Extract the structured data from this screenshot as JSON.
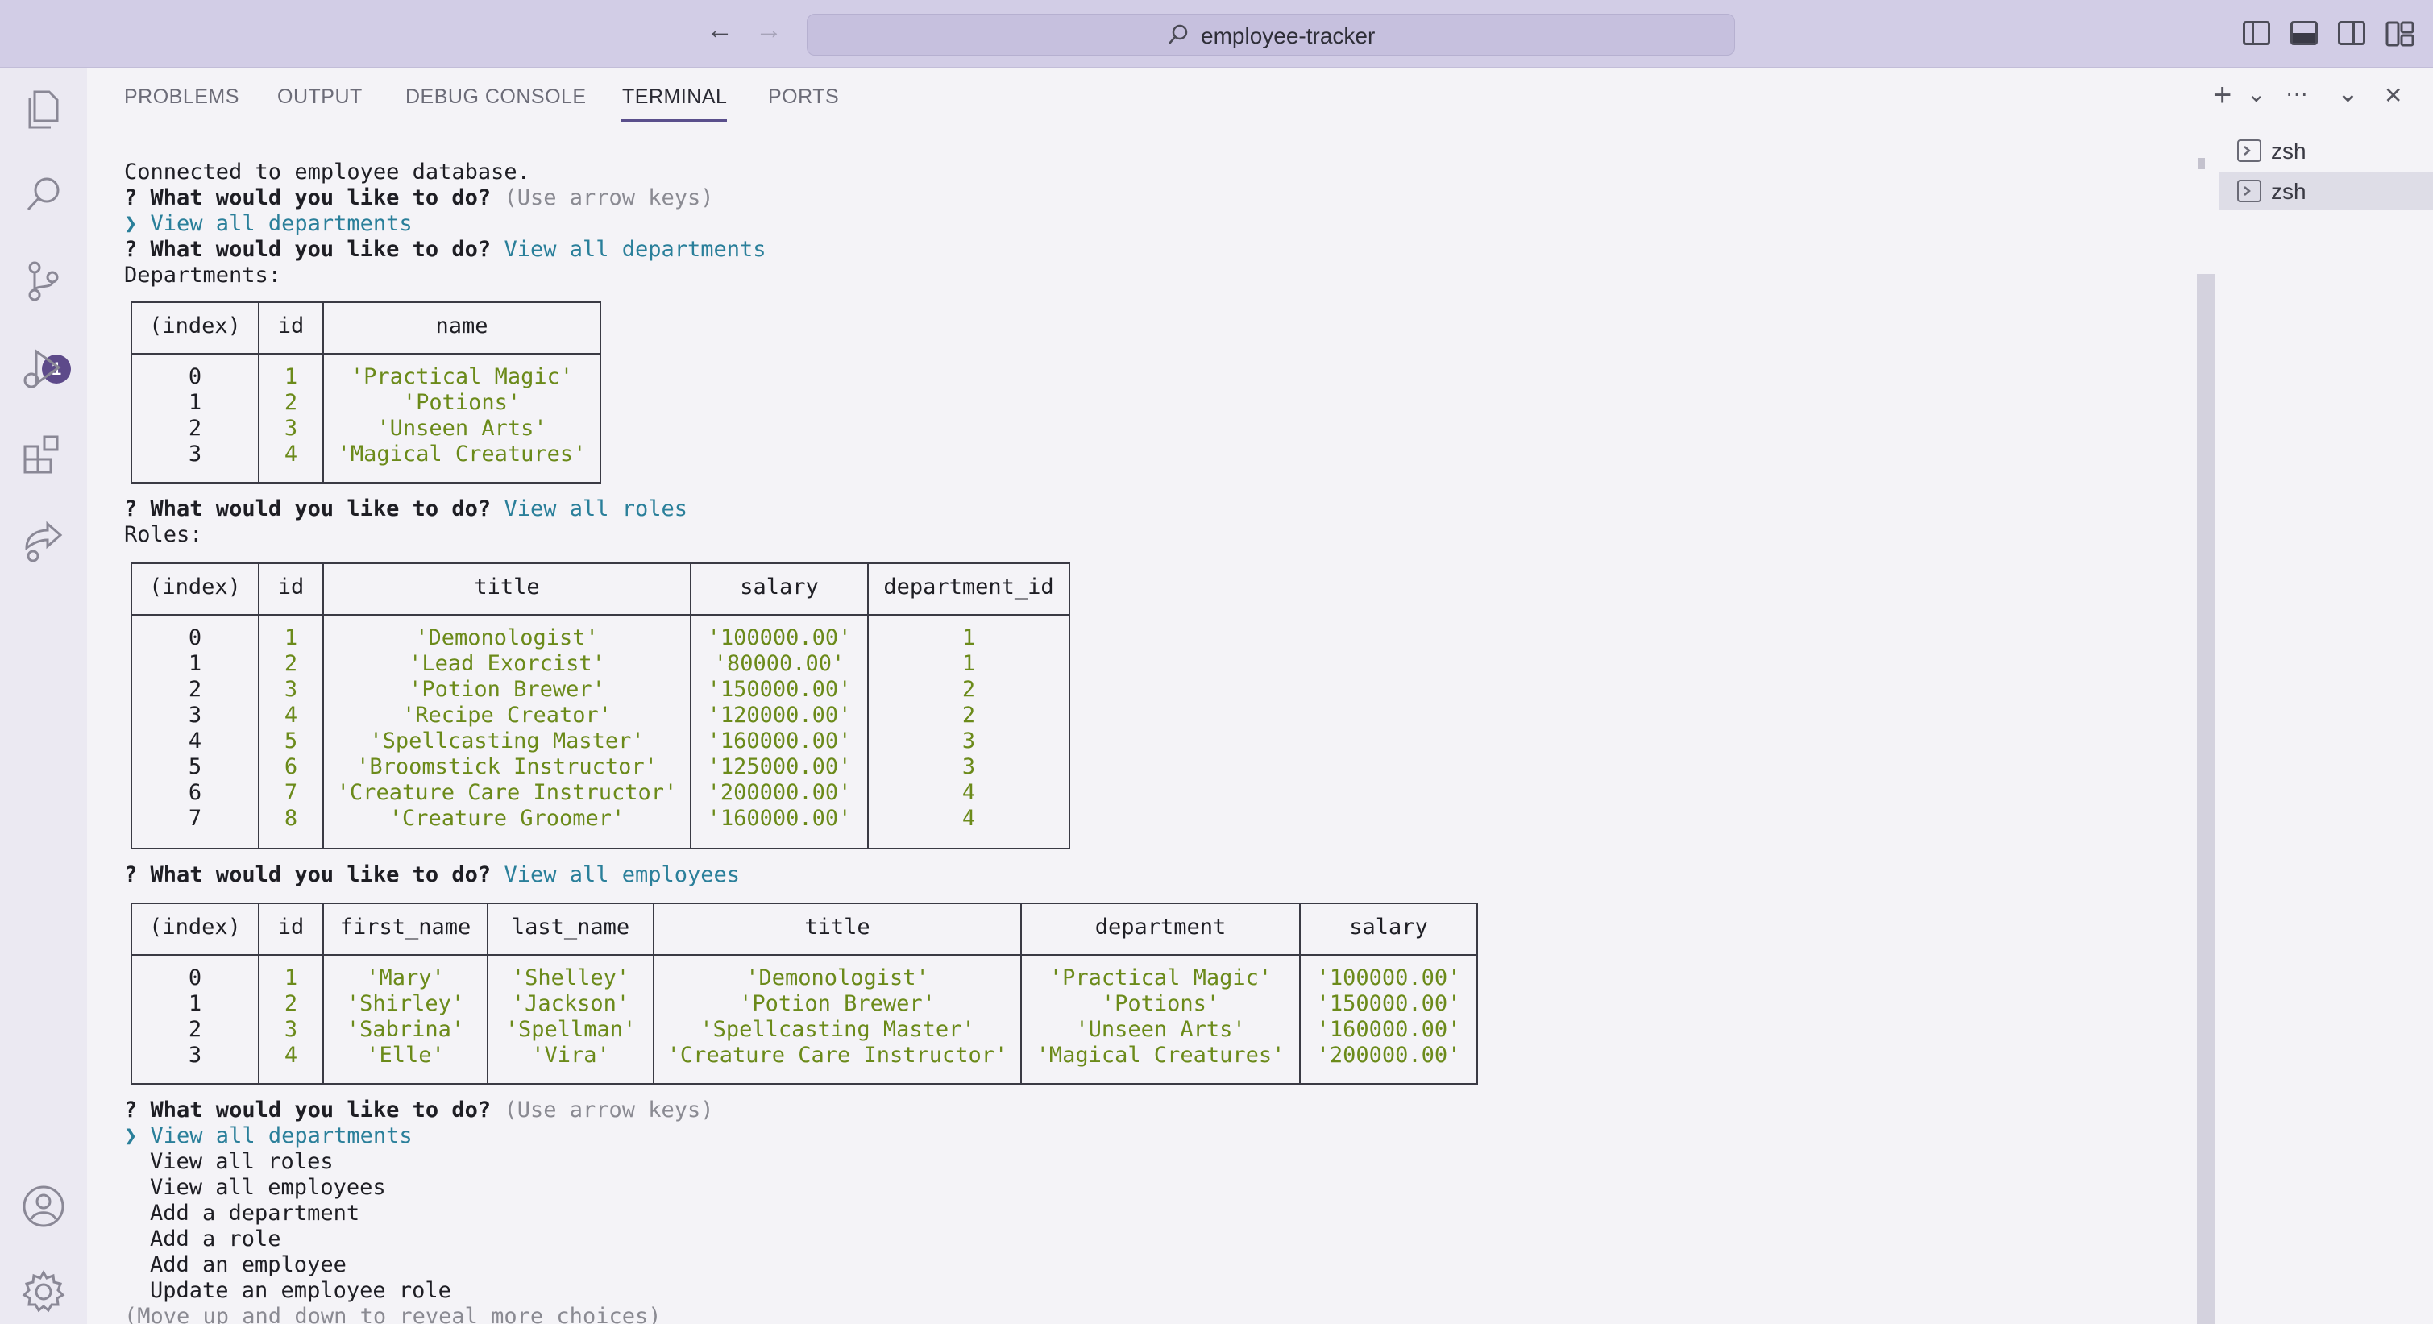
{
  "window": {
    "title": "employee-tracker"
  },
  "panel_tabs": [
    "PROBLEMS",
    "OUTPUT",
    "DEBUG CONSOLE",
    "TERMINAL",
    "PORTS"
  ],
  "active_tab": "TERMINAL",
  "source_control_badge": "1",
  "terminals": [
    "zsh",
    "zsh"
  ],
  "icons": {
    "back": "←",
    "forward": "→",
    "add": "+",
    "dropdown": "⌄",
    "more": "···",
    "collapse": "⌄",
    "close": "✕"
  },
  "terminal": {
    "connected": "Connected to employee database.",
    "prompt_mark": "?",
    "prompt_question": "What would you like to do?",
    "hint": "(Use arrow keys)",
    "pointer": "❯",
    "first_selection": "View all departments",
    "answer_departments": "View all departments",
    "departments_label": "Departments:",
    "answer_roles": "View all roles",
    "roles_label": "Roles:",
    "answer_employees": "View all employees",
    "menu_choices": [
      "View all departments",
      "View all roles",
      "View all employees",
      "Add a department",
      "Add a role",
      "Add an employee",
      "Update an employee role"
    ],
    "more_choices_hint": "(Move up and down to reveal more choices)"
  },
  "departments_table": {
    "headers": [
      "(index)",
      "id",
      "name"
    ],
    "rows": [
      [
        "0",
        "1",
        "'Practical Magic'"
      ],
      [
        "1",
        "2",
        "'Potions'"
      ],
      [
        "2",
        "3",
        "'Unseen Arts'"
      ],
      [
        "3",
        "4",
        "'Magical Creatures'"
      ]
    ]
  },
  "roles_table": {
    "headers": [
      "(index)",
      "id",
      "title",
      "salary",
      "department_id"
    ],
    "rows": [
      [
        "0",
        "1",
        "'Demonologist'",
        "'100000.00'",
        "1"
      ],
      [
        "1",
        "2",
        "'Lead Exorcist'",
        "'80000.00'",
        "1"
      ],
      [
        "2",
        "3",
        "'Potion Brewer'",
        "'150000.00'",
        "2"
      ],
      [
        "3",
        "4",
        "'Recipe Creator'",
        "'120000.00'",
        "2"
      ],
      [
        "4",
        "5",
        "'Spellcasting Master'",
        "'160000.00'",
        "3"
      ],
      [
        "5",
        "6",
        "'Broomstick Instructor'",
        "'125000.00'",
        "3"
      ],
      [
        "6",
        "7",
        "'Creature Care Instructor'",
        "'200000.00'",
        "4"
      ],
      [
        "7",
        "8",
        "'Creature Groomer'",
        "'160000.00'",
        "4"
      ]
    ]
  },
  "employees_table": {
    "headers": [
      "(index)",
      "id",
      "first_name",
      "last_name",
      "title",
      "department",
      "salary"
    ],
    "rows": [
      [
        "0",
        "1",
        "'Mary'",
        "'Shelley'",
        "'Demonologist'",
        "'Practical Magic'",
        "'100000.00'"
      ],
      [
        "1",
        "2",
        "'Shirley'",
        "'Jackson'",
        "'Potion Brewer'",
        "'Potions'",
        "'150000.00'"
      ],
      [
        "2",
        "3",
        "'Sabrina'",
        "'Spellman'",
        "'Spellcasting Master'",
        "'Unseen Arts'",
        "'160000.00'"
      ],
      [
        "3",
        "4",
        "'Elle'",
        "'Vira'",
        "'Creature Care Instructor'",
        "'Magical Creatures'",
        "'200000.00'"
      ]
    ]
  }
}
